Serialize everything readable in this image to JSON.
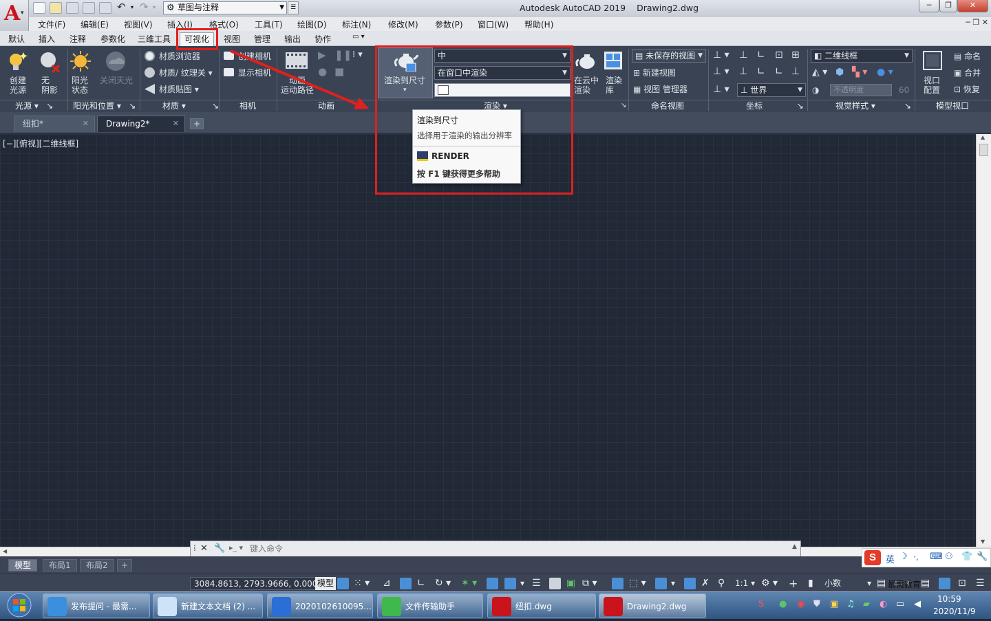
{
  "window": {
    "title": "Autodesk AutoCAD 2019",
    "document": "Drawing2.dwg",
    "workspace": "草图与注释"
  },
  "menubar": [
    "文件(F)",
    "编辑(E)",
    "视图(V)",
    "插入(I)",
    "格式(O)",
    "工具(T)",
    "绘图(D)",
    "标注(N)",
    "修改(M)",
    "参数(P)",
    "窗口(W)",
    "帮助(H)"
  ],
  "ribbon_tabs": [
    "默认",
    "插入",
    "注释",
    "参数化",
    "三维工具",
    "可视化",
    "视图",
    "管理",
    "输出",
    "协作"
  ],
  "ribbon_tabs_active": "可视化",
  "panels": {
    "light": {
      "title": "光源",
      "create": "创建\n光源",
      "no_shadow": "无\n阴影"
    },
    "sun": {
      "title": "阳光和位置",
      "sun_status": "阳光\n状态",
      "sky_off": "关闭天光"
    },
    "materials": {
      "title": "材质",
      "browser": "材质浏览器",
      "texture": "材质/ 纹理关",
      "mapping": "材质贴图"
    },
    "camera": {
      "title": "相机",
      "create": "创建相机",
      "show": "显示相机"
    },
    "animation": {
      "title": "动画",
      "motion_path": "动画\n运动路径"
    },
    "render": {
      "title": "渲染",
      "to_size": "渲染到尺寸",
      "quality": "中",
      "where": "在窗口中渲染",
      "cloud": "在云中\n渲染",
      "library": "渲染\n库"
    },
    "named_views": {
      "title": "命名视图",
      "unsaved": "未保存的视图",
      "new_view": "新建视图",
      "manager": "视图 管理器"
    },
    "coordinates": {
      "title": "坐标",
      "world": "世界"
    },
    "visual_styles": {
      "title": "视觉样式",
      "style": "二维线框",
      "opacity_label": "不透明度",
      "opacity_value": "60"
    },
    "model_viewports": {
      "title": "模型视口",
      "config": "视口\n配置",
      "name": "命名",
      "join": "合并",
      "restore": "恢复"
    }
  },
  "tooltip": {
    "title": "渲染到尺寸",
    "description": "选择用于渲染的输出分辨率",
    "command": "RENDER",
    "help": "按 F1 键获得更多帮助"
  },
  "doc_tabs": [
    "纽扣*",
    "Drawing2*"
  ],
  "viewport_label": "[−][俯视][二维线框]",
  "command_placeholder": "键入命令",
  "layout_tabs": [
    "模型",
    "布局1",
    "布局2"
  ],
  "status": {
    "coords": "3084.8613, 2793.9666, 0.0000",
    "space": "模型",
    "scale": "1:1",
    "units": "小数"
  },
  "ime": {
    "lang": "英"
  },
  "taskbar": {
    "items": [
      "发布提问 - 最需...",
      "新建文本文档 (2) ...",
      "2020102610095...",
      "文件传输助手",
      "纽扣.dwg",
      "Drawing2.dwg"
    ],
    "time": "10:59",
    "date": "2020/11/9",
    "watermark": "最需教育"
  },
  "colors": {
    "accent_red": "#e0201c",
    "ribbon_bg": "#3a4354",
    "canvas_bg": "#212836"
  }
}
